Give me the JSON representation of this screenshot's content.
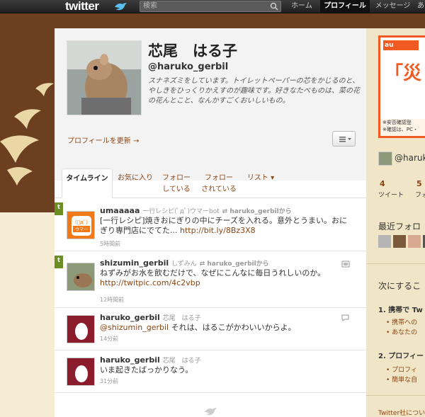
{
  "topbar": {
    "logo": "twitter",
    "search_placeholder": "検索",
    "nav": [
      "ホーム",
      "プロフィール",
      "メッセージ",
      "あ"
    ]
  },
  "profile": {
    "display_name": "芯尾　はる子",
    "screen_name": "@haruko_gerbil",
    "bio": "スナネズミをしています。トイレットペーパーの芯をかじるのと、やしきをひっくりかえすのが趣味です。好きなたべものは、菜の花の花んとこと、なんかすごくおいしいもの。",
    "update_link": "プロフィールを更新 →"
  },
  "tabs": [
    {
      "label": "タイムライン",
      "sub": ""
    },
    {
      "label": "お気に入り",
      "sub": ""
    },
    {
      "label": "フォロー",
      "sub": "している"
    },
    {
      "label": "フォロー",
      "sub": "されている"
    },
    {
      "label": "リスト ▾",
      "sub": ""
    }
  ],
  "tweets": [
    {
      "user": "umaaaaa",
      "fullname": "一行レシピ(ﾟдﾟ)ウマーbot",
      "rt_from": "haruko_gerbilから",
      "text": "[一行レシピ]焼きおにぎりの中にチーズを入れる。意外とうまい。おにぎり専門店にでてた...",
      "link": "http://bit.ly/8Bz3X8",
      "time": "5時間前"
    },
    {
      "user": "shizumin_gerbil",
      "fullname": "しずみん",
      "rt_from": "haruko_gerbilから",
      "text": "ねずみがお水を飲むだけで、なぜにこんなに毎日うれしいのか。",
      "link": "http://twitpic.com/4c2vbp",
      "time": "12時間前"
    },
    {
      "user": "haruko_gerbil",
      "fullname": "芯尾　はる子",
      "mention": "@shizumin_gerbil",
      "text": " それは、はるこがかわいいからよ。",
      "time": "14分前"
    },
    {
      "user": "haruko_gerbil",
      "fullname": "芯尾　はる子",
      "text": "いま起きたばっかりなう。",
      "time": "31分前"
    }
  ],
  "sidebar": {
    "ad_logo": "au",
    "ad_big": "「災",
    "ad_foot1": "※安否確認登",
    "ad_foot2": "※確認は、PC・",
    "handle": "@haruk",
    "tweets_count": "4",
    "tweets_label": "ツイート",
    "following_count": "5",
    "following_label": "フォ",
    "followers_heading": "最近フォロ",
    "next_heading": "次にするこ",
    "step1": "1.  携帯で Tw",
    "step1_a": "携帯への",
    "step1_b": "あなたの",
    "step2": "2.  プロフィー",
    "step2_a": "プロフィ",
    "step2_b": "簡単な自",
    "footer": "Twitter社につい"
  },
  "colors": {
    "brand_brown": "#6b3f1f",
    "link": "#8b4513",
    "accent_orange": "#f15a22"
  }
}
